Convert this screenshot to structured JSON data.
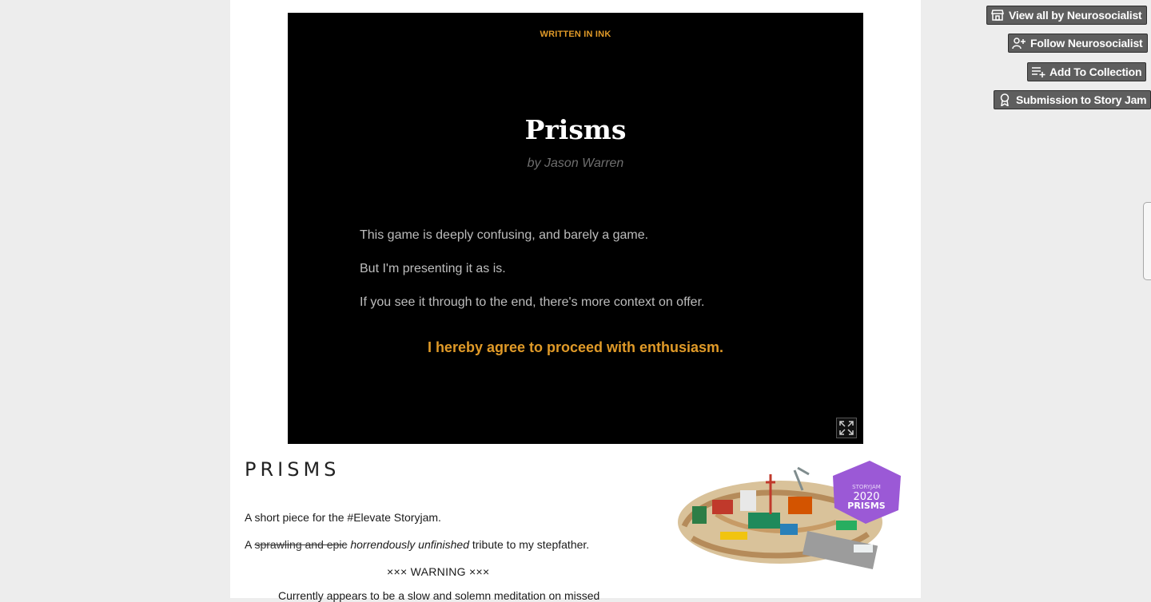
{
  "sidebar": {
    "view_all": "View all by Neurosocialist",
    "follow": "Follow Neurosocialist",
    "add_collection": "Add To Collection",
    "story_jam": "Submission to Story Jam"
  },
  "game": {
    "credit": "WRITTEN IN INK",
    "title": "Prisms",
    "byline": "by Jason Warren",
    "paragraphs": [
      "This game is deeply confusing, and barely a game.",
      "But I'm presenting it as is.",
      "If you see it through to the end, there's more context on offer."
    ],
    "choice": "I hereby agree to proceed with enthusiasm.",
    "fullscreen_icon": "expand-icon"
  },
  "description": {
    "heading": "PRISMS",
    "line1": "A short piece for the #Elevate Storyjam.",
    "line2_prefix": "A",
    "line2_struck": "sprawling and epic",
    "line2_italic": "horrendously unfinished",
    "line2_suffix": "tribute to my stepfather.",
    "warning": "××× WARNING ×××",
    "cutoff": "Currently appears to be a slow and solemn meditation on missed",
    "badge": {
      "line1": "STORYJAM",
      "line2": "2020",
      "line3": "PRISMS"
    }
  },
  "colors": {
    "accent": "#e09a28",
    "badge_purple": "#9b59d6",
    "button_bg": "#5e5e5e"
  }
}
